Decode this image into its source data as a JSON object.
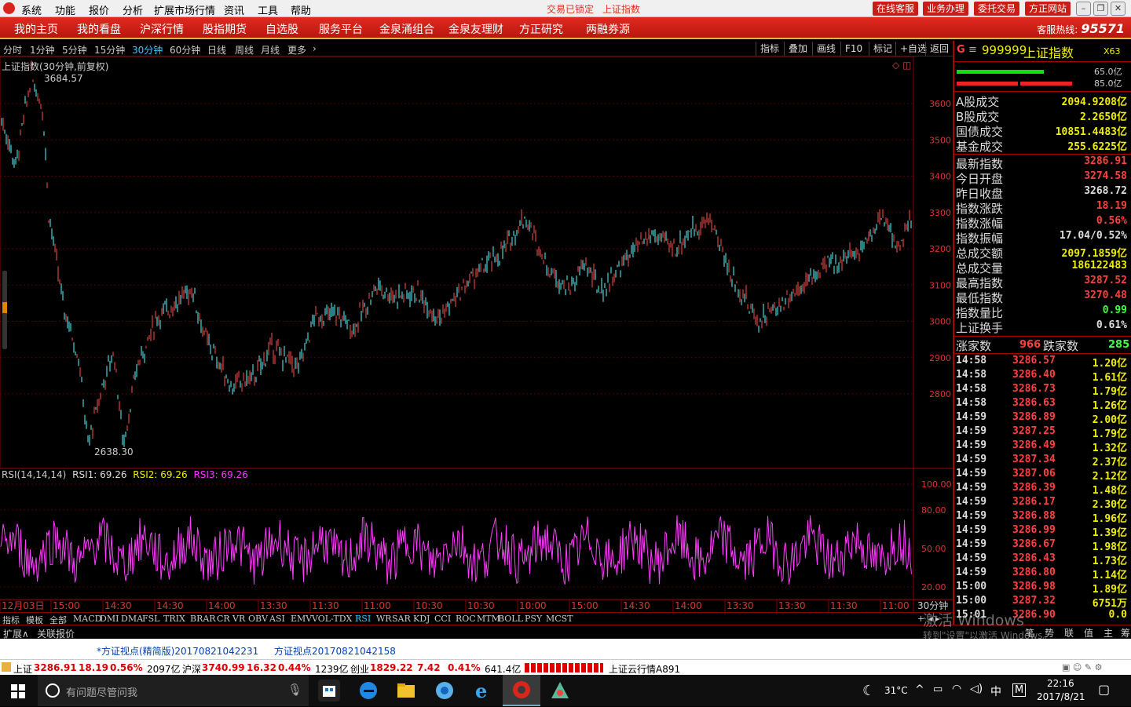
{
  "menubar": {
    "items": [
      "系统",
      "功能",
      "报价",
      "分析",
      "扩展市场行情",
      "资讯",
      "工具",
      "帮助"
    ],
    "status_locked": "交易已锁定",
    "status_index": "上证指数",
    "buttons": [
      "在线客服",
      "业务办理",
      "委托交易",
      "方正网站"
    ]
  },
  "nav": {
    "items": [
      "我的主页",
      "我的看盘",
      "沪深行情",
      "股指期货",
      "自选股",
      "服务平台",
      "金泉涌组合",
      "金泉友理财",
      "方正研究",
      "两融券源"
    ],
    "hotline_label": "客服热线:",
    "hotline_number": "95571"
  },
  "periods": {
    "items": [
      "分时",
      "1分钟",
      "5分钟",
      "15分钟",
      "30分钟",
      "60分钟",
      "日线",
      "周线",
      "月线",
      "更多"
    ],
    "active": "30分钟",
    "tools": [
      "指标",
      "叠加",
      "画线",
      "F10",
      "标记",
      "+自选",
      "返回"
    ]
  },
  "main_chart": {
    "title": "上证指数(30分钟,前复权)",
    "high_label": "3684.57",
    "low_label": "2638.30",
    "y_ticks": [
      "3600",
      "3500",
      "3400",
      "3300",
      "3200",
      "3100",
      "3000",
      "2900",
      "2800"
    ]
  },
  "rsi": {
    "label": "RSI(14,14,14)",
    "rsi1": "RSI1: 69.26",
    "rsi2": "RSI2: 69.26",
    "rsi3": "RSI3: 69.26",
    "y_ticks": [
      "100.00",
      "80.00",
      "50.00",
      "20.00"
    ]
  },
  "x_axis": {
    "labels": [
      "12月03日",
      "15:00",
      "14:30",
      "14:30",
      "14:00",
      "13:30",
      "11:30",
      "11:00",
      "10:30",
      "10:30",
      "10:00",
      "15:00",
      "14:30",
      "14:00",
      "13:30",
      "13:30",
      "11:30",
      "11:00"
    ],
    "period": "30分钟"
  },
  "indicator_tabs": {
    "items": [
      "指标",
      "模板",
      "全部",
      "MACD",
      "DMI",
      "DMA",
      "FSL",
      "TRIX",
      "BRAR",
      "CR",
      "VR",
      "OBV",
      "ASI",
      "EMV",
      "VOL-TDX",
      "RSI",
      "WR",
      "SAR",
      "KDJ",
      "CCI",
      "ROC",
      "MTM",
      "BOLL",
      "PSY",
      "MCST"
    ],
    "active": "RSI"
  },
  "extension": {
    "expand": "扩展∧",
    "related": "关联报价"
  },
  "quote": {
    "code": "999999",
    "name": "上证指数",
    "tag": "X63",
    "bar1": "65.0亿",
    "bar2": "85.0亿",
    "turnover": [
      {
        "label": "A股成交",
        "value": "2094.9208亿"
      },
      {
        "label": "B股成交",
        "value": "2.2650亿"
      },
      {
        "label": "国债成交",
        "value": "10851.4483亿"
      },
      {
        "label": "基金成交",
        "value": "255.6225亿"
      }
    ],
    "stats": [
      {
        "label": "最新指数",
        "value": "3286.91",
        "color": "#ff4040"
      },
      {
        "label": "今日开盘",
        "value": "3274.58",
        "color": "#ff4040"
      },
      {
        "label": "昨日收盘",
        "value": "3268.72",
        "color": "#dddddd"
      },
      {
        "label": "指数涨跌",
        "value": "18.19",
        "color": "#ff4040"
      },
      {
        "label": "指数涨幅",
        "value": "0.56%",
        "color": "#ff4040"
      },
      {
        "label": "指数振幅",
        "value": "17.04/0.52%",
        "color": "#dddddd"
      },
      {
        "label": "总成交额",
        "value": "2097.1859亿",
        "color": "#eeee00"
      },
      {
        "label": "总成交量",
        "value": "186122483",
        "color": "#eeee00"
      },
      {
        "label": "最高指数",
        "value": "3287.52",
        "color": "#ff4040"
      },
      {
        "label": "最低指数",
        "value": "3270.48",
        "color": "#ff4040"
      },
      {
        "label": "指数量比",
        "value": "0.99",
        "color": "#40ff40"
      },
      {
        "label": "上证换手",
        "value": "0.61%",
        "color": "#dddddd"
      }
    ],
    "up_label": "涨家数",
    "up_count": "966",
    "down_label": "跌家数",
    "down_count": "285",
    "ticks": [
      [
        "14:58",
        "3286.57",
        "1.20亿"
      ],
      [
        "14:58",
        "3286.40",
        "1.61亿"
      ],
      [
        "14:58",
        "3286.73",
        "1.79亿"
      ],
      [
        "14:58",
        "3286.63",
        "1.26亿"
      ],
      [
        "14:59",
        "3286.89",
        "2.00亿"
      ],
      [
        "14:59",
        "3287.25",
        "1.79亿"
      ],
      [
        "14:59",
        "3286.49",
        "1.32亿"
      ],
      [
        "14:59",
        "3287.34",
        "2.37亿"
      ],
      [
        "14:59",
        "3287.06",
        "2.12亿"
      ],
      [
        "14:59",
        "3286.39",
        "1.48亿"
      ],
      [
        "14:59",
        "3286.17",
        "2.30亿"
      ],
      [
        "14:59",
        "3286.88",
        "1.96亿"
      ],
      [
        "14:59",
        "3286.99",
        "1.39亿"
      ],
      [
        "14:59",
        "3286.67",
        "1.98亿"
      ],
      [
        "14:59",
        "3286.43",
        "1.73亿"
      ],
      [
        "14:59",
        "3286.80",
        "1.14亿"
      ],
      [
        "15:00",
        "3286.98",
        "1.89亿"
      ],
      [
        "15:00",
        "3287.32",
        "6751万"
      ],
      [
        "15:01",
        "3286.90",
        "0.0"
      ]
    ],
    "bottom_tabs": [
      "笔",
      "势",
      "联",
      "值",
      "主",
      "筹"
    ]
  },
  "watermark": {
    "line1": "激活 Windows",
    "line2": "转到\"设置\"以激活 Windows。"
  },
  "news": {
    "item1": "*方证视点(精简版)20170821042231",
    "item2": "方证视点20170821042158"
  },
  "ticker": {
    "sh_label": "上证",
    "sh_val": "3286.91",
    "sh_chg": "18.19",
    "sh_pct": "0.56%",
    "sh_amt": "2097亿",
    "hs_label": "沪深",
    "hs_val": "3740.99",
    "hs_chg": "16.32",
    "hs_pct": "0.44%",
    "hs_amt": "1239亿",
    "cy_label": "创业",
    "cy_val": "1829.22",
    "cy_chg": "7.42",
    "cy_pct": "0.41%",
    "cy_amt": "641.4亿",
    "cloud": "上证云行情A891"
  },
  "taskbar": {
    "search_placeholder": "有问题尽管问我",
    "temp": "31°C",
    "ime": "中",
    "ime2": "M",
    "time": "22:16",
    "date": "2017/8/21"
  }
}
